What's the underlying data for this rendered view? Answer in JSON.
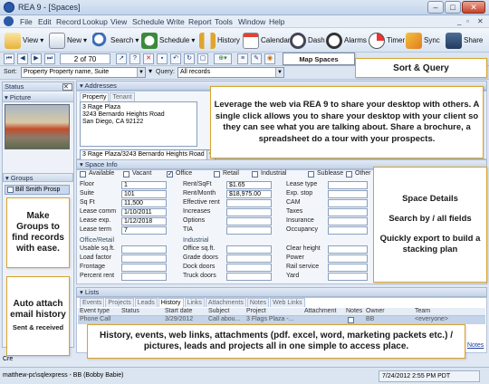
{
  "window": {
    "title": "REA 9 - [Spaces]"
  },
  "menu": [
    "File",
    "Edit",
    "Record",
    "Lookup",
    "View",
    "Schedule",
    "Write",
    "Report",
    "Tools",
    "Window",
    "Help"
  ],
  "toolbar": {
    "view": "View",
    "new": "New",
    "search": "Search",
    "schedule": "Schedule",
    "history": "History",
    "calendar": "Calendar",
    "dash": "Dash",
    "alarms": "Alarms",
    "timer": "Timer",
    "sync": "Sync",
    "share": "Share"
  },
  "nav": {
    "record_counter": "2 of 70",
    "map_spaces": "Map Spaces"
  },
  "sort": {
    "label": "Sort:",
    "value": "Property Property name, Suite",
    "query_label": "Query:",
    "query_value": "All records"
  },
  "left": {
    "status": "Status",
    "picture": "Picture",
    "groups": "Groups",
    "group_item": "Bill Smith Prosp"
  },
  "addresses": {
    "section": "Addresses",
    "tab_property": "Property",
    "tab_tenant": "Tenant",
    "line1": "3 Rage Plaza",
    "line2": "3243 Bernardo Heights Road",
    "line3": "San Diego, CA 92122",
    "combo": "3 Rage Plaza/3243 Bernardo Heights Road"
  },
  "space_info": {
    "section": "Space Info",
    "types": [
      "Available",
      "Vacant",
      "Office",
      "Retail",
      "Industrial",
      "Sublease",
      "Other"
    ],
    "checked": [
      false,
      false,
      true,
      false,
      false,
      false,
      false
    ],
    "col1": [
      [
        "Floor",
        "1"
      ],
      [
        "Suite",
        "101"
      ],
      [
        "Sq Ft",
        "11,500"
      ],
      [
        "Lease comm",
        "1/10/2011"
      ],
      [
        "Lease exp.",
        "1/12/2018"
      ],
      [
        "Lease term",
        "7"
      ]
    ],
    "col2": [
      [
        "Rent/SqFt",
        "$1.65"
      ],
      [
        "Rent/Month",
        "$18,975.00"
      ],
      [
        "Effective rent",
        ""
      ],
      [
        "Increases",
        ""
      ],
      [
        "Options",
        ""
      ],
      [
        "TIA",
        ""
      ]
    ],
    "col3": [
      [
        "Lease type",
        ""
      ],
      [
        "Exp. stop",
        ""
      ],
      [
        "CAM",
        ""
      ],
      [
        "Taxes",
        ""
      ],
      [
        "Insurance",
        ""
      ],
      [
        "Occupancy",
        ""
      ]
    ],
    "office_retail": "Office/Retail",
    "industrial": "Industrial",
    "col1b": [
      "Usable sq.ft.",
      "Load factor",
      "Frontage",
      "Percent rent"
    ],
    "col2b": [
      "Office sq.ft.",
      "Grade doors",
      "Dock doors",
      "Truck doors"
    ],
    "col3b": [
      "Clear height",
      "Power",
      "Rail service",
      "Yard"
    ]
  },
  "lists": {
    "section": "Lists",
    "tabs": [
      "Events",
      "Projects",
      "Leads",
      "History",
      "Links",
      "Attachments",
      "Notes",
      "Web Links"
    ],
    "active_tab": "History",
    "headers": [
      "Event type",
      "Status",
      "Start date",
      "Subject",
      "Project",
      "Attachment",
      "Notes",
      "Owner",
      "Team"
    ],
    "row": [
      "Phone Call",
      "",
      "3/29/2012",
      "Call abou...",
      "3 Flags Plaza -...",
      "",
      "",
      "BB",
      "<everyone>"
    ]
  },
  "status": {
    "left": "matthew-pc\\sqlexpress - BB (Bobby Babie)",
    "right": "7/24/2012 2:55 PM PDT",
    "notes_link": "Notes",
    "cre": "Cre"
  },
  "callouts": {
    "sort_query": "Sort & Query",
    "share": "Leverage the web via REA 9 to share your desktop with others. A single click allows you to share your desktop with your client so they can see what you are talking about. Share a brochure, a spreadsheet do a tour with your prospects.",
    "groups": "Make Groups to find records with ease.",
    "space_details": "Space Details",
    "search_by": "Search by / all fields",
    "export": "Quickly export to build a stacking plan",
    "auto_attach": "Auto attach email history",
    "sent_received": "Sent & received",
    "history": "History, events, web links, attachments (pdf. excel, word, marketing packets etc.) / pictures, leads and projects all in one simple to access place."
  },
  "colors": {
    "callout_border": "#d8a22d",
    "title_bg": "#c3d4ea",
    "accent": "#2a5aa8"
  }
}
